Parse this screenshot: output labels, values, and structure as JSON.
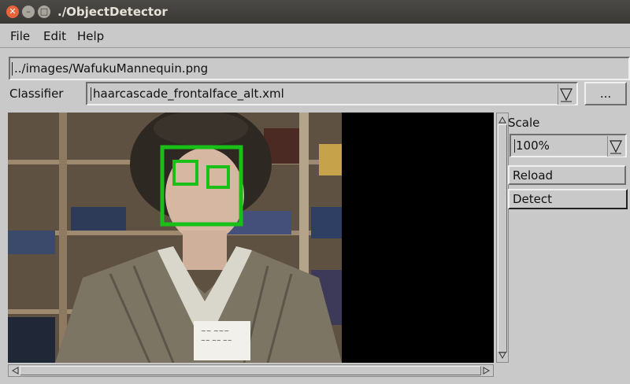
{
  "window": {
    "title": "./ObjectDetector"
  },
  "menu": {
    "file": "File",
    "edit": "Edit",
    "help": "Help"
  },
  "image_path": {
    "value": "../images/WafukuMannequin.png"
  },
  "classifier": {
    "label": "Classifier",
    "value": "haarcascade_frontalface_alt.xml",
    "browse_label": "..."
  },
  "scale": {
    "label": "Scale",
    "value": "100%"
  },
  "buttons": {
    "reload": "Reload",
    "detect": "Detect"
  },
  "colors": {
    "detection_box": "#18c018",
    "titlebar": "#3c3b37",
    "close_button": "#e8643a",
    "canvas_background": "#000000"
  },
  "detections": {
    "faces": 1,
    "eyes": 2
  }
}
